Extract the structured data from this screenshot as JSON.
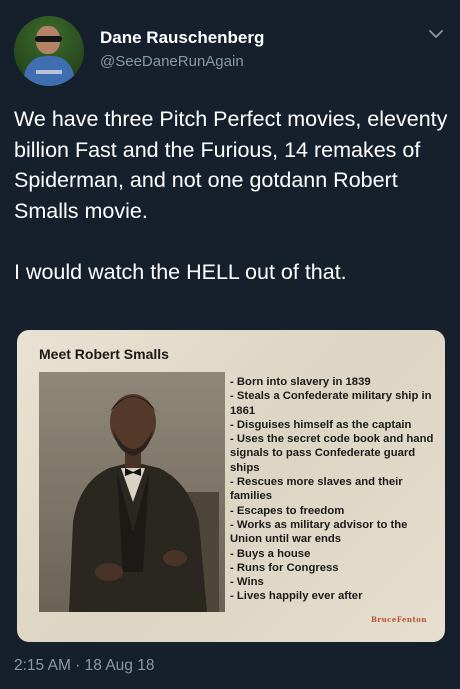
{
  "author": {
    "name": "Dane Rauschenberg",
    "handle": "@SeeDaneRunAgain"
  },
  "tweet": {
    "text": "We have three Pitch Perfect movies, eleventy billion Fast and the Furious, 14 remakes of Spiderman, and not one gotdann Robert Smalls  movie.\n\nI would watch the HELL out of that."
  },
  "media": {
    "title": "Meet Robert Smalls",
    "facts": [
      "- Born into slavery in 1839",
      "- Steals a Confederate military ship in 1861",
      "- Disguises himself as the captain",
      "- Uses the secret code book and hand signals to pass Confederate guard ships",
      "- Rescues more slaves and their families",
      "- Escapes to freedom",
      "- Works as military advisor to the Union until war ends",
      "- Buys a house",
      "- Runs for Congress",
      "- Wins",
      "- Lives happily ever after"
    ],
    "signature": "BruceFenton"
  },
  "timestamp": "2:15 AM · 18 Aug 18",
  "icons": {
    "menu": "chevron-down-icon"
  },
  "colors": {
    "background": "#16202c",
    "secondary_text": "#8899a6",
    "text": "#ffffff"
  }
}
